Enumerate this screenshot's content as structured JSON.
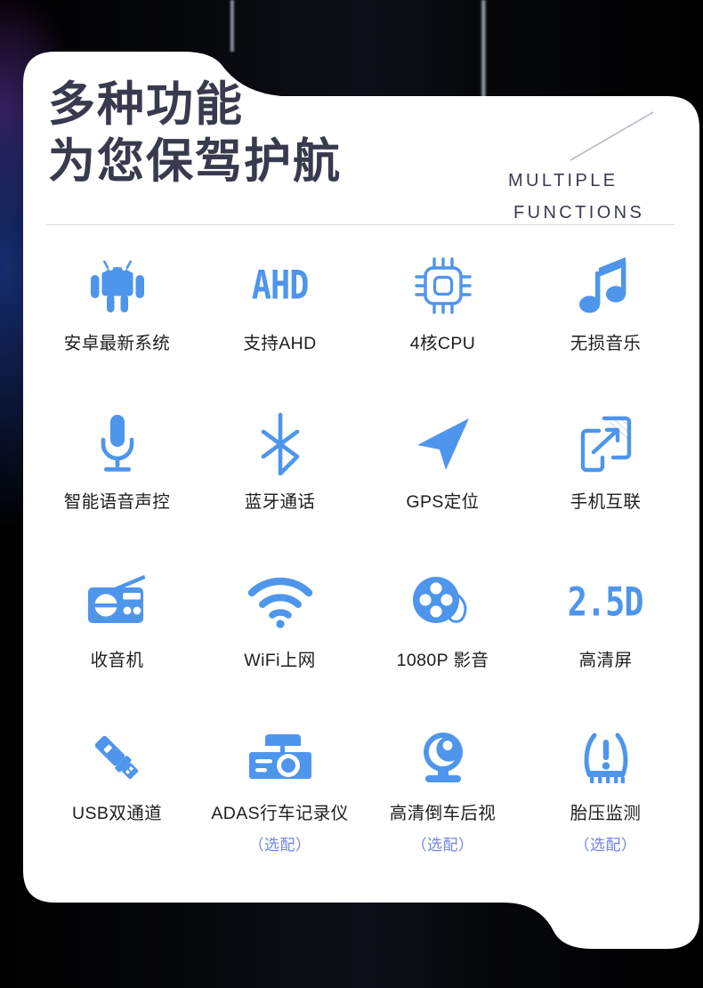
{
  "theme": {
    "icon_blue": "#4e95ec",
    "title_navy": "#383a4d",
    "label_black": "#1d1d1f",
    "optional_blue": "#6f83e8",
    "card_white": "#ffffff",
    "backdrop_black": "#000000",
    "divider_gray": "#d6d8dd"
  },
  "header": {
    "title_line1": "多种功能",
    "title_line2": "为您保驾护航",
    "kicker_line1": "MULTIPLE",
    "kicker_line2": "FUNCTIONS",
    "decor": "diagonal-slash"
  },
  "features": [
    {
      "icon": "android-robot-icon",
      "label": "安卓最新系统",
      "optional": ""
    },
    {
      "icon": "ahd-text-logo",
      "label": "支持AHD",
      "optional": "",
      "text_logo": "AHD"
    },
    {
      "icon": "cpu-chip-icon",
      "label": "4核CPU",
      "optional": ""
    },
    {
      "icon": "music-note-icon",
      "label": "无损音乐",
      "optional": ""
    },
    {
      "icon": "microphone-icon",
      "label": "智能语音声控",
      "optional": ""
    },
    {
      "icon": "bluetooth-icon",
      "label": "蓝牙通话",
      "optional": ""
    },
    {
      "icon": "navigation-arrow-icon",
      "label": "GPS定位",
      "optional": ""
    },
    {
      "icon": "phone-link-icon",
      "label": "手机互联",
      "optional": ""
    },
    {
      "icon": "radio-icon",
      "label": "收音机",
      "optional": ""
    },
    {
      "icon": "wifi-icon",
      "label": "WiFi上网",
      "optional": ""
    },
    {
      "icon": "film-reel-icon",
      "label": "1080P 影音",
      "optional": ""
    },
    {
      "icon": "25d-text-logo",
      "label": "高清屏",
      "optional": "",
      "text_logo": "2.5D"
    },
    {
      "icon": "usb-drive-icon",
      "label": "USB双通道",
      "optional": ""
    },
    {
      "icon": "dashcam-icon",
      "label": "ADAS行车记录仪",
      "optional": "（选配）"
    },
    {
      "icon": "rear-camera-icon",
      "label": "高清倒车后视",
      "optional": "（选配）"
    },
    {
      "icon": "tire-pressure-icon",
      "label": "胎压监测",
      "optional": "（选配）"
    }
  ]
}
